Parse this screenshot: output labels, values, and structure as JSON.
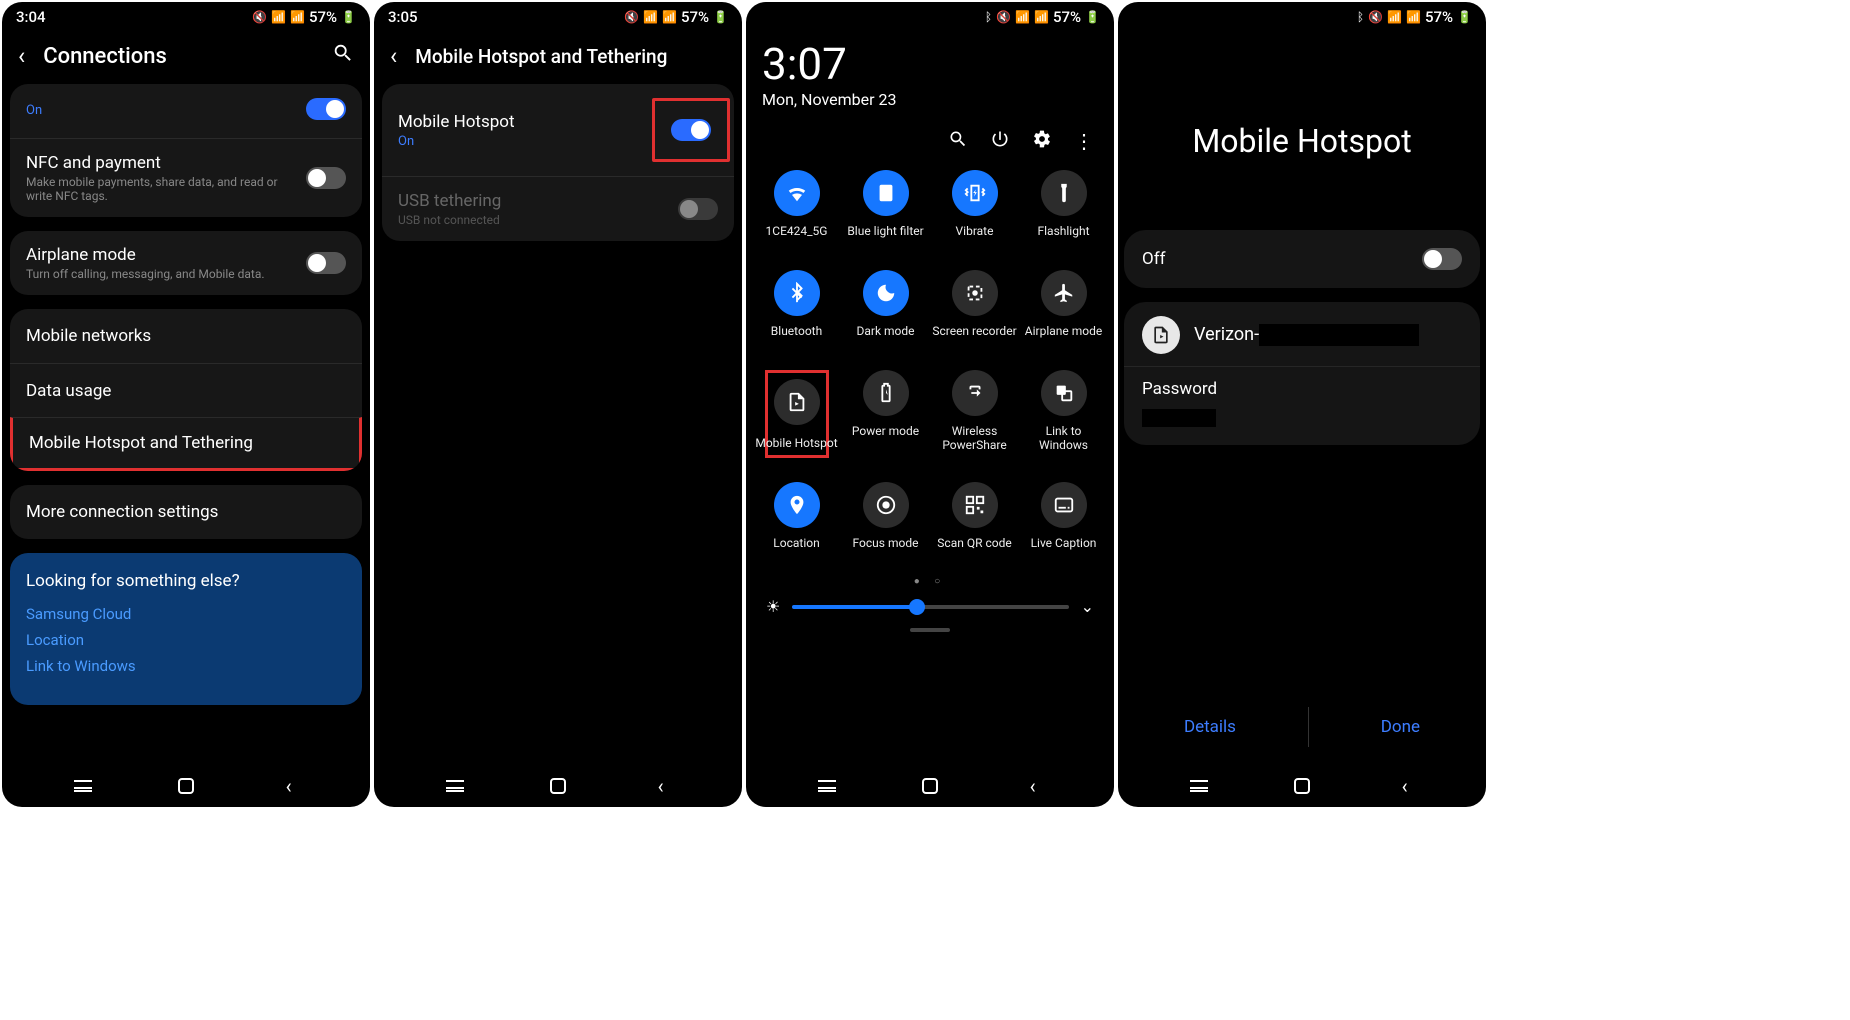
{
  "status": {
    "time1": "3:04",
    "time2": "3:05",
    "battery": "57%",
    "icons": "🔕 📶 📶 57% 🔋"
  },
  "panel1": {
    "title": "Connections",
    "on_text": "On",
    "nfc": {
      "title": "NFC and payment",
      "sub": "Make mobile payments, share data, and read or write NFC tags."
    },
    "airplane": {
      "title": "Airplane mode",
      "sub": "Turn off calling, messaging, and Mobile data."
    },
    "mobile_networks": "Mobile networks",
    "data_usage": "Data usage",
    "hotspot": "Mobile Hotspot and Tethering",
    "more": "More connection settings",
    "looking": {
      "head": "Looking for something else?",
      "link1": "Samsung Cloud",
      "link2": "Location",
      "link3": "Link to Windows"
    }
  },
  "panel2": {
    "title": "Mobile Hotspot and Tethering",
    "hotspot": {
      "title": "Mobile Hotspot",
      "on": "On"
    },
    "usb": {
      "title": "USB tethering",
      "sub": "USB not connected"
    }
  },
  "panel3": {
    "time": "3:07",
    "date": "Mon, November 23",
    "tiles": [
      {
        "name": "wifi",
        "label": "1CE424_5G",
        "active": true,
        "glyph": "wifi"
      },
      {
        "name": "bluelight",
        "label": "Blue light filter",
        "active": true,
        "glyph": "bluelight"
      },
      {
        "name": "vibrate",
        "label": "Vibrate",
        "active": true,
        "glyph": "vibrate"
      },
      {
        "name": "flashlight",
        "label": "Flashlight",
        "active": false,
        "glyph": "flashlight"
      },
      {
        "name": "bluetooth",
        "label": "Bluetooth",
        "active": true,
        "glyph": "bt"
      },
      {
        "name": "darkmode",
        "label": "Dark mode",
        "active": true,
        "glyph": "moon"
      },
      {
        "name": "screenrecorder",
        "label": "Screen recorder",
        "active": false,
        "glyph": "screen"
      },
      {
        "name": "airplane",
        "label": "Airplane mode",
        "active": false,
        "glyph": "plane"
      },
      {
        "name": "hotspot",
        "label": "Mobile Hotspot",
        "active": false,
        "glyph": "hotspot",
        "highlight": true
      },
      {
        "name": "power",
        "label": "Power mode",
        "active": false,
        "glyph": "battery"
      },
      {
        "name": "powershare",
        "label": "Wireless PowerShare",
        "active": false,
        "glyph": "share"
      },
      {
        "name": "linkwindows",
        "label": "Link to Windows",
        "active": false,
        "glyph": "link"
      },
      {
        "name": "location",
        "label": "Location",
        "active": true,
        "glyph": "pin"
      },
      {
        "name": "focus",
        "label": "Focus mode",
        "active": false,
        "glyph": "target"
      },
      {
        "name": "scanqr",
        "label": "Scan QR code",
        "active": false,
        "glyph": "qr"
      },
      {
        "name": "caption",
        "label": "Live Caption",
        "active": false,
        "glyph": "caption"
      }
    ]
  },
  "panel4": {
    "title": "Mobile Hotspot",
    "off": "Off",
    "ssid_prefix": "Verizon-",
    "password_label": "Password",
    "details": "Details",
    "done": "Done"
  }
}
